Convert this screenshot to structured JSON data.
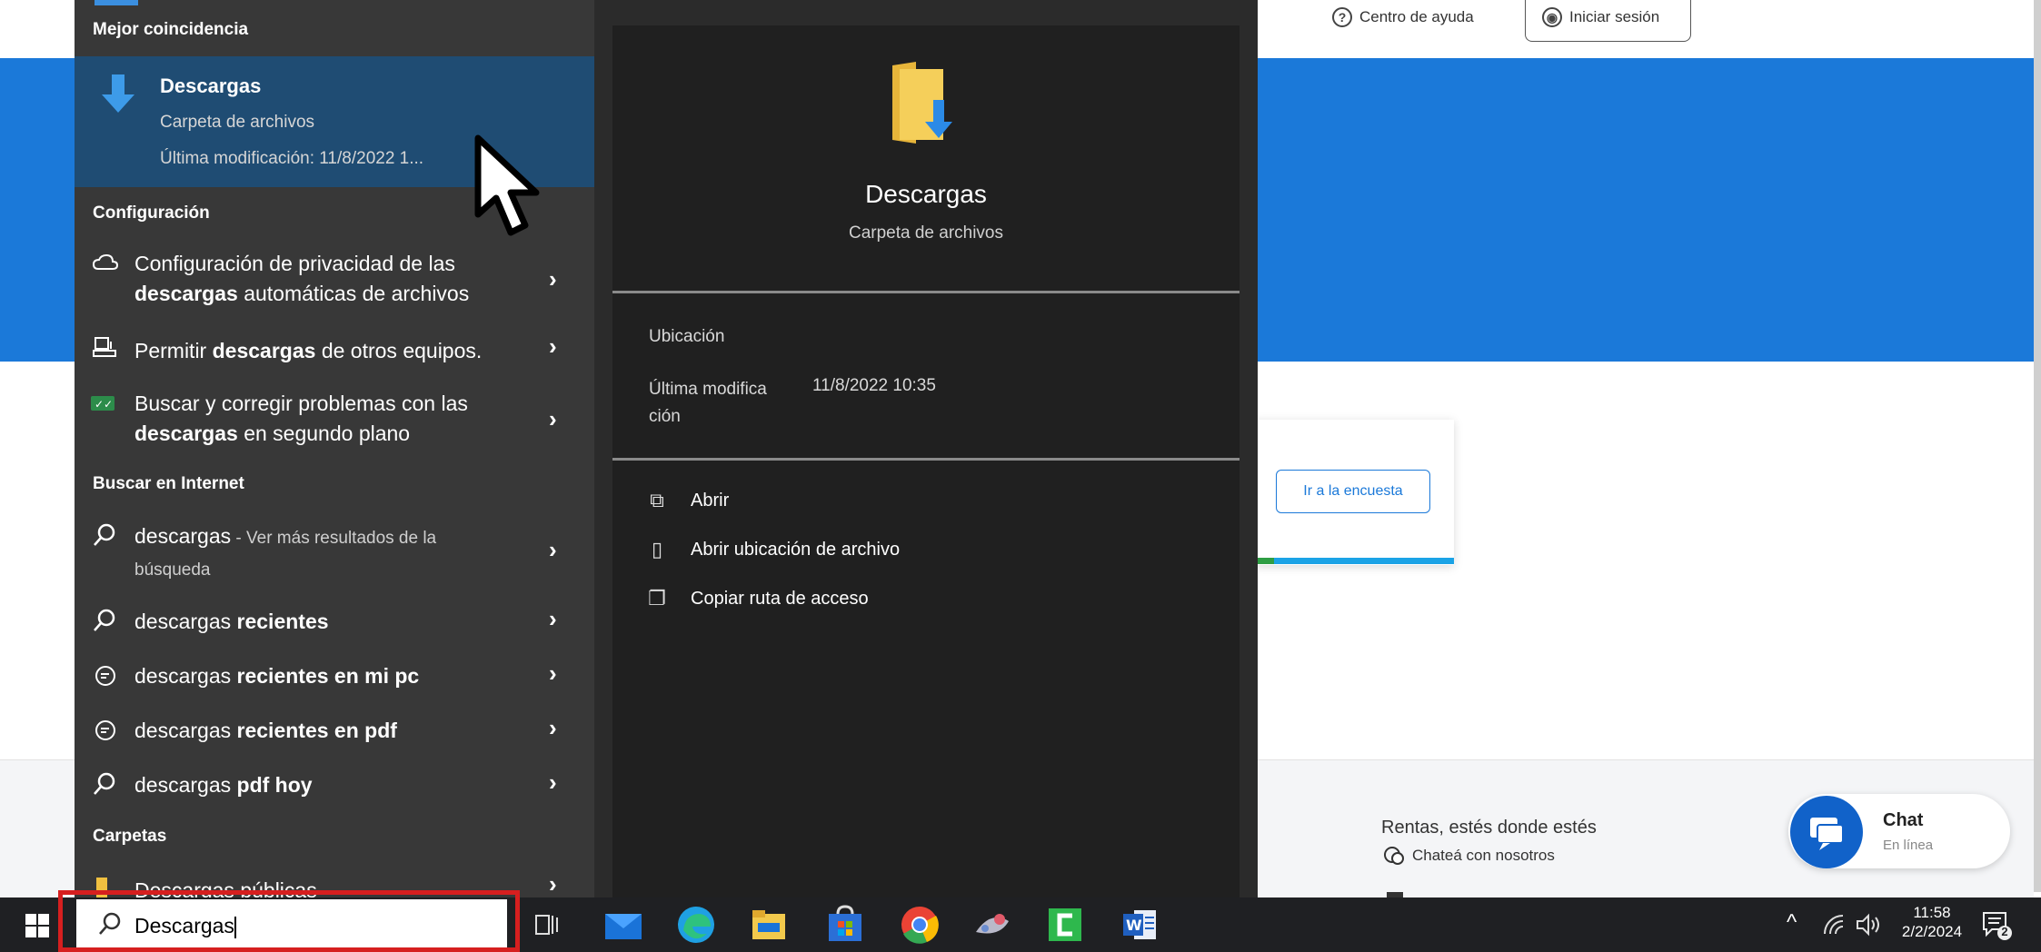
{
  "website": {
    "help_label": "Centro de ayuda",
    "login_label": "Iniciar sesión",
    "survey_button": "Ir a la encuesta",
    "footer_title": "Rentas, estés donde estés",
    "footer_chat_link": "Chateá con nosotros",
    "chat_label": "Chat",
    "chat_status": "En línea"
  },
  "search_menu": {
    "best_match_header": "Mejor coincidencia",
    "best_match": {
      "title": "Descargas",
      "type": "Carpeta de archivos",
      "modified": "Última modificación: 11/8/2022 1..."
    },
    "settings_header": "Configuración",
    "settings_items": [
      {
        "line1_pre": "Configuración de privacidad de las",
        "line2_bold": "descargas",
        "line2_post": " automáticas de archivos"
      },
      {
        "pre": "Permitir ",
        "bold": "descargas",
        "post": " de otros equipos."
      },
      {
        "line1_pre": "Buscar y corregir problemas con las",
        "line2_bold": "descargas",
        "line2_post": " en segundo plano"
      }
    ],
    "web_header": "Buscar en Internet",
    "web_items": [
      {
        "text": "descargas",
        "suffix": " - Ver más resultados de la",
        "suffix2": "búsqueda"
      },
      {
        "pre": "descargas ",
        "bold": "recientes"
      },
      {
        "pre": "descargas ",
        "bold": "recientes en mi pc"
      },
      {
        "pre": "descargas ",
        "bold": "recientes en pdf"
      },
      {
        "pre": "descargas ",
        "bold": "pdf hoy"
      }
    ],
    "folders_header": "Carpetas",
    "folder_item": "Descargas públicas",
    "detail": {
      "title": "Descargas",
      "type": "Carpeta de archivos",
      "location_label": "Ubicación",
      "modified_label_1": "Última modifica",
      "modified_label_2": "ción",
      "modified_value": "11/8/2022 10:35",
      "actions": [
        "Abrir",
        "Abrir ubicación de archivo",
        "Copiar ruta de acceso"
      ]
    }
  },
  "taskbar": {
    "search_value": "Descargas",
    "time": "11:58",
    "date": "2/2/2024",
    "notification_count": "2"
  }
}
